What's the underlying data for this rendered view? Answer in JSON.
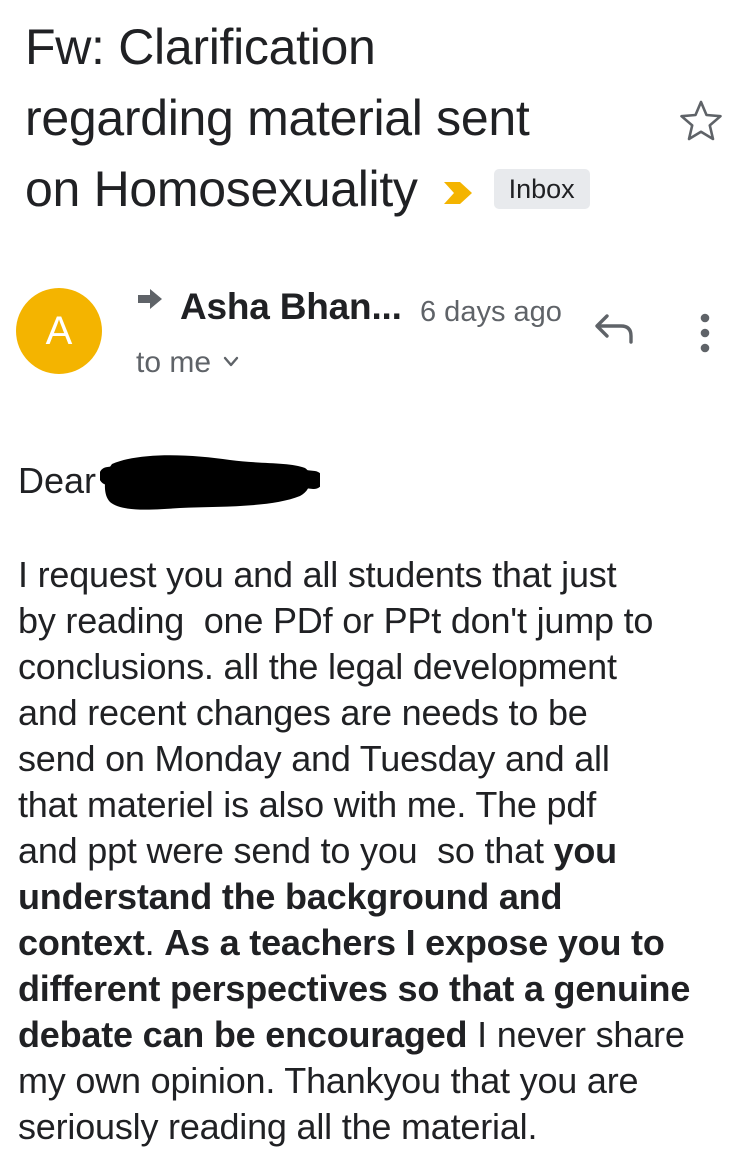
{
  "email": {
    "subject_lines": [
      "Fw: Clarification",
      "regarding material sent",
      "on Homosexuality"
    ],
    "label_chip": "Inbox",
    "importance_icon": "importance-marker-icon",
    "accent_colors": {
      "importance": "#f4b400",
      "avatar": "#f4b400"
    }
  },
  "sender": {
    "avatar_letter": "A",
    "name": "Asha Bhan...",
    "time": "6 days ago",
    "recipient": "to me"
  },
  "body": {
    "greeting": "Dear",
    "lines": [
      {
        "segments": [
          {
            "text": "I request you and all students that just",
            "bold": false
          }
        ]
      },
      {
        "segments": [
          {
            "text": "by reading  one PDf or PPt don't jump to",
            "bold": false
          }
        ]
      },
      {
        "segments": [
          {
            "text": "conclusions. all the legal development",
            "bold": false
          }
        ]
      },
      {
        "segments": [
          {
            "text": "and recent changes are needs to be",
            "bold": false
          }
        ]
      },
      {
        "segments": [
          {
            "text": "send on Monday and Tuesday and all",
            "bold": false
          }
        ]
      },
      {
        "segments": [
          {
            "text": "that materiel is also with me. The pdf",
            "bold": false
          }
        ]
      },
      {
        "segments": [
          {
            "text": "and ppt were send to you  so that ",
            "bold": false
          },
          {
            "text": "you",
            "bold": true
          }
        ]
      },
      {
        "segments": [
          {
            "text": "understand the background and",
            "bold": true
          }
        ]
      },
      {
        "segments": [
          {
            "text": "context",
            "bold": true
          },
          {
            "text": ". ",
            "bold": false
          },
          {
            "text": "As a teachers I expose you to",
            "bold": true
          }
        ]
      },
      {
        "segments": [
          {
            "text": "different perspectives so that a genuine",
            "bold": true
          }
        ]
      },
      {
        "segments": [
          {
            "text": "debate can be encouraged",
            "bold": true
          },
          {
            "text": " I never share",
            "bold": false
          }
        ]
      },
      {
        "segments": [
          {
            "text": "my own opinion. Thankyou that you are",
            "bold": false
          }
        ]
      },
      {
        "segments": [
          {
            "text": "seriously reading all the material.",
            "bold": false
          }
        ]
      }
    ]
  }
}
